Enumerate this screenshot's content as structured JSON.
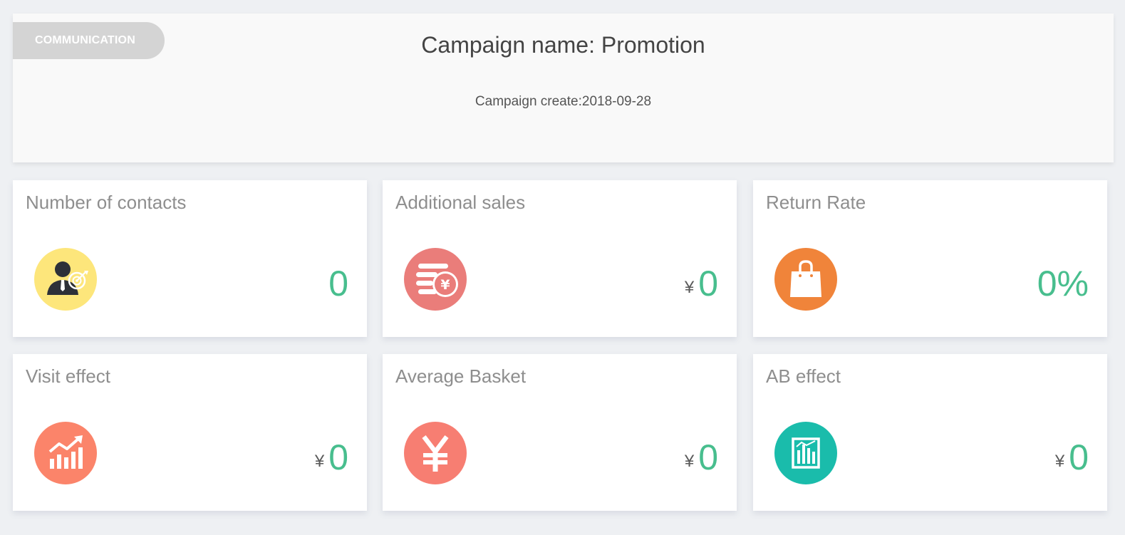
{
  "header": {
    "badge": "COMMUNICATION",
    "title": "Campaign name: Promotion",
    "created": "Campaign create:2018-09-28"
  },
  "cards": [
    {
      "title": "Number of contacts",
      "currency": "",
      "value": "0",
      "icon": "contact-target-icon",
      "color": "#fde67b"
    },
    {
      "title": "Additional sales",
      "currency": "¥",
      "value": "0",
      "icon": "coins-yen-icon",
      "color": "#ea7d7a"
    },
    {
      "title": "Return Rate",
      "currency": "",
      "value": "0%",
      "icon": "shopping-bag-icon",
      "color": "#f0843a"
    },
    {
      "title": "Visit effect",
      "currency": "¥",
      "value": "0",
      "icon": "trend-chart-icon",
      "color": "#fb846a"
    },
    {
      "title": "Average Basket",
      "currency": "¥",
      "value": "0",
      "icon": "yen-icon",
      "color": "#f77e72"
    },
    {
      "title": "AB effect",
      "currency": "¥",
      "value": "0",
      "icon": "bar-report-icon",
      "color": "#1abcab"
    }
  ],
  "colors": {
    "value": "#48be8e",
    "badge": "#d4d4d4",
    "page_background": "#eef0f3"
  }
}
